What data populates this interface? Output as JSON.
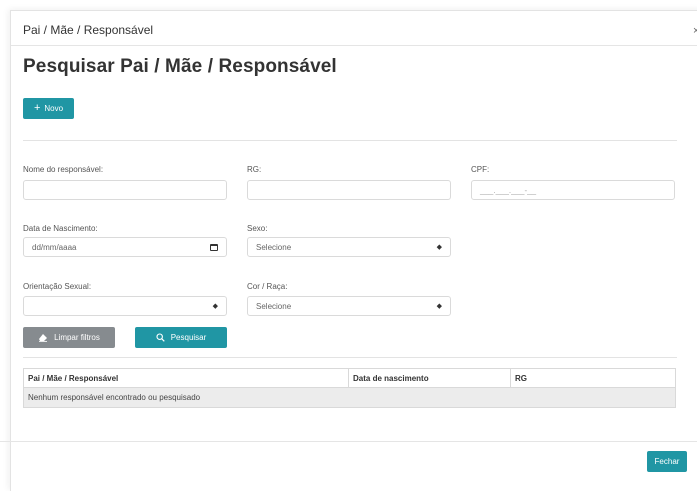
{
  "modal": {
    "title": "Pai / Mãe / Responsável",
    "close_label": "×"
  },
  "page_title": "Pesquisar Pai / Mãe / Responsável",
  "new_button": {
    "icon": "+",
    "label": "Novo"
  },
  "fields": {
    "nome": {
      "label": "Nome do responsável:",
      "value": ""
    },
    "rg": {
      "label": "RG:",
      "value": ""
    },
    "cpf": {
      "label": "CPF:",
      "placeholder": "___.___.___-__"
    },
    "nascimento": {
      "label": "Data de Nascimento:",
      "placeholder": "dd/mm/aaaa"
    },
    "sexo": {
      "label": "Sexo:",
      "selected": "Selecione"
    },
    "orientacao": {
      "label": "Orientação Sexual:",
      "selected": ""
    },
    "cor": {
      "label": "Cor / Raça:",
      "selected": "Selecione"
    }
  },
  "actions": {
    "clear_label": "Limpar filtros",
    "search_label": "Pesquisar"
  },
  "table": {
    "headers": [
      "Pai / Mãe / Responsável",
      "Data de nascimento",
      "RG"
    ],
    "empty_message": "Nenhum responsável encontrado ou pesquisado"
  },
  "footer": {
    "close_label": "Fechar"
  },
  "colors": {
    "primary": "#2096a4",
    "secondary": "#868b8f",
    "empty_row_bg": "#ececec"
  }
}
